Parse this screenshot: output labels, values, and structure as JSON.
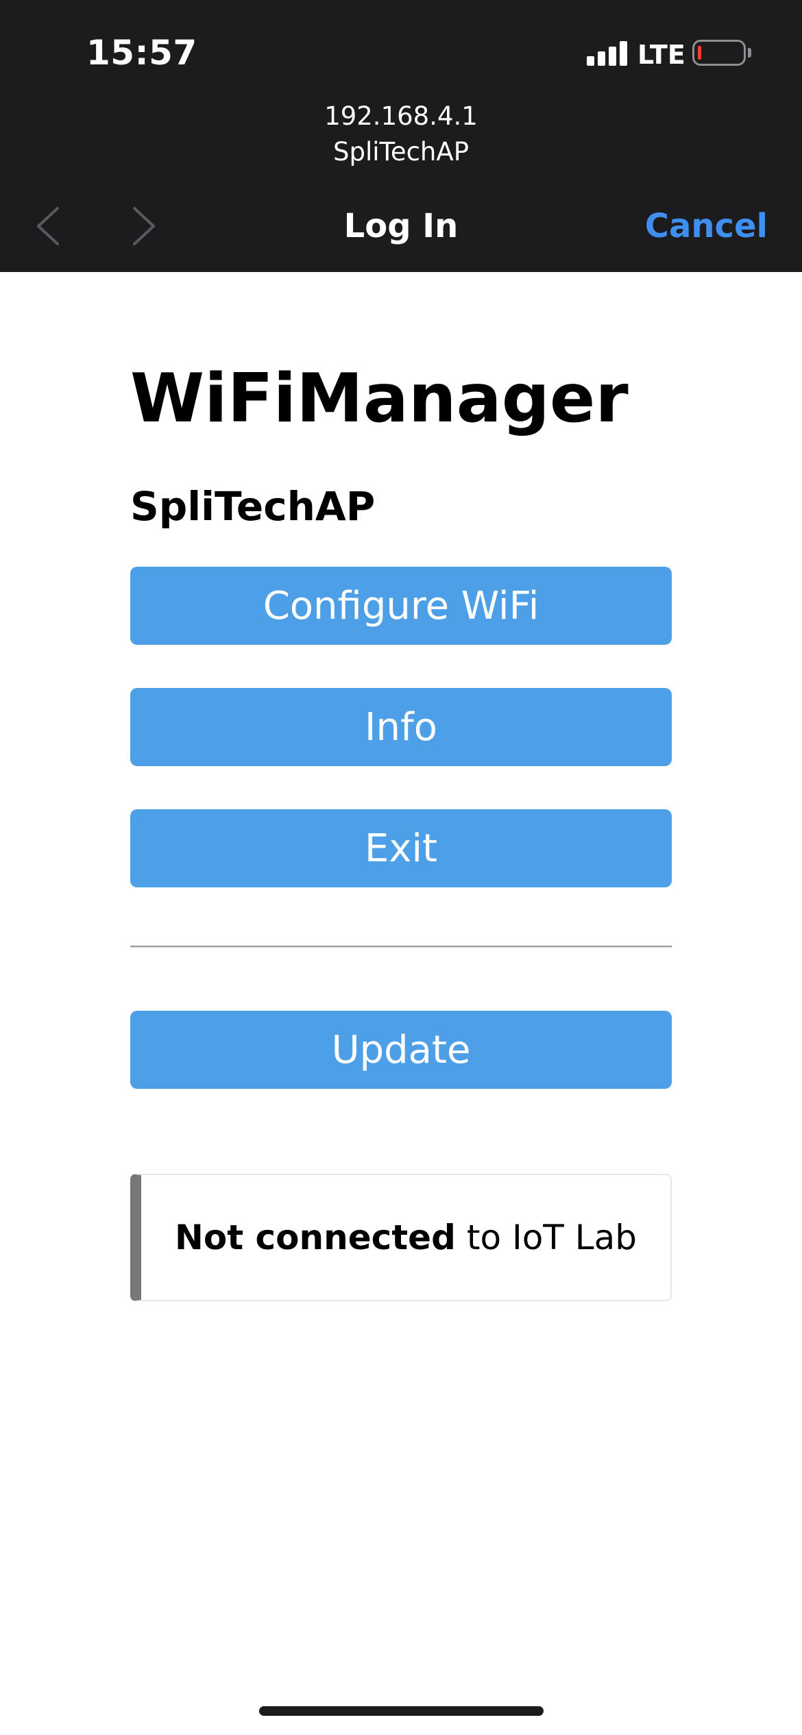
{
  "status_bar": {
    "time": "15:57",
    "network": "LTE",
    "battery_color": "#ff3b30"
  },
  "browser": {
    "url": "192.168.4.1",
    "subtitle": "SpliTechAP",
    "title": "Log In",
    "cancel_label": "Cancel",
    "back_icon": "chevron-left-icon",
    "forward_icon": "chevron-right-icon",
    "accent_color": "#3e8ff0"
  },
  "page": {
    "title": "WiFiManager",
    "ssid": "SpliTechAP",
    "buttons": {
      "configure": "Configure WiFi",
      "info": "Info",
      "exit": "Exit",
      "update": "Update"
    },
    "button_color": "#4d9fe7",
    "message": {
      "bold": "Not connected",
      "rest": "to IoT Lab"
    }
  }
}
